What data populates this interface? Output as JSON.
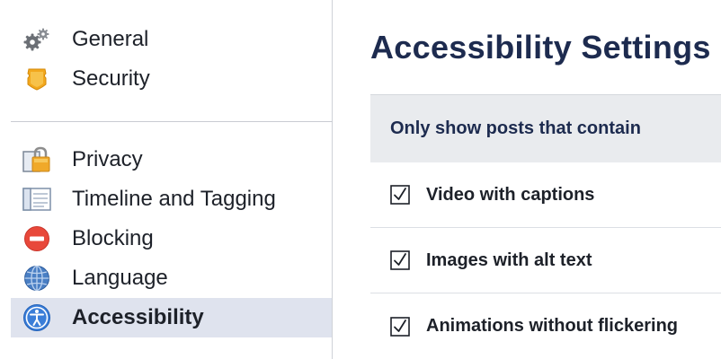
{
  "sidebar": {
    "top_items": [
      {
        "label": "General",
        "icon": "gears-icon"
      },
      {
        "label": "Security",
        "icon": "badge-icon"
      }
    ],
    "bottom_items": [
      {
        "label": "Privacy",
        "icon": "lock-icon"
      },
      {
        "label": "Timeline and Tagging",
        "icon": "timeline-icon"
      },
      {
        "label": "Blocking",
        "icon": "blocking-icon"
      },
      {
        "label": "Language",
        "icon": "globe-icon"
      },
      {
        "label": "Accessibility",
        "icon": "accessibility-icon",
        "active": true
      }
    ]
  },
  "main": {
    "title": "Accessibility Settings",
    "section_header": "Only show posts that contain",
    "options": [
      {
        "label": "Video with captions",
        "checked": true
      },
      {
        "label": "Images with alt text",
        "checked": true
      },
      {
        "label": "Animations without flickering",
        "checked": true
      }
    ]
  },
  "colors": {
    "active_background": "#dfe3ee",
    "title": "#1d2b4f",
    "section_header_background": "#e9ebee"
  }
}
